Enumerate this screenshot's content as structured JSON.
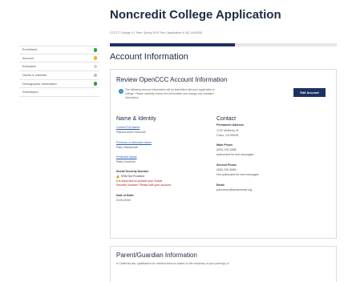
{
  "header": {
    "title": "Noncredit College Application",
    "breadcrumb": "CCCTC College X  |  Term: Spring 2019 Test  |  Application #: NC-1400938",
    "progress": 0.55
  },
  "sidebar": {
    "items": [
      {
        "label": "Enrollment",
        "status": "complete",
        "color": "#2e9e47"
      },
      {
        "label": "Account",
        "status": "warning",
        "color": "#f0b41c"
      },
      {
        "label": "Education",
        "status": "incomplete",
        "color": "#cfcfcf"
      },
      {
        "label": "Needs & Interests",
        "status": "incomplete",
        "color": "#bbbbbb"
      },
      {
        "label": "Demographic Information",
        "status": "complete",
        "color": "#2e9e47"
      },
      {
        "label": "Submission",
        "status": "none",
        "color": ""
      }
    ]
  },
  "main": {
    "section_title": "Account Information",
    "review_card": {
      "title": "Review OpenCCC Account Information",
      "info_line1": "The following account information will be submitted with your application to",
      "info_line2": "college. Please carefully review this information and change any outdated",
      "info_line3": "information.",
      "edit_button": "Edit Account"
    },
    "identity": {
      "title": "Name & Identity",
      "current_name_label": "Current Full Name",
      "current_name": "Patricia Anne Donohue",
      "previous_name_label": "Previous or Alternate Name",
      "previous_name": "Patty Wadsworth",
      "preferred_name_label": "Preferred Name",
      "preferred_name": "Patty Donohue",
      "ssn_label": "Social Security Number",
      "ssn_status": "SSN Not Provided",
      "ssn_warning_line1": "It is important to provide your Social",
      "ssn_warning_line2": "Security Number. Please edit your account.",
      "dob_label": "Date of Birth",
      "dob": "01/01/2000"
    },
    "contact": {
      "title": "Contact",
      "address_label": "Permanent Address",
      "address_line1": "1722 Mulberry St",
      "address_line2": "Chico, CA 95928",
      "main_phone_label": "Main Phone",
      "main_phone": "(530) 226-3486",
      "main_phone_note": "Authorized for text messages",
      "second_phone_label": "Second Phone",
      "second_phone": "(530) 330-8080",
      "second_phone_note": "Not authorized for text messages",
      "email_label": "Email",
      "email": "pdonohue@studentmail.org"
    },
    "parent_card": {
      "title": "Parent/Guardian Information",
      "text": "In California law, qualification for resident tuition is based on the residency of your parent(s) or"
    }
  }
}
